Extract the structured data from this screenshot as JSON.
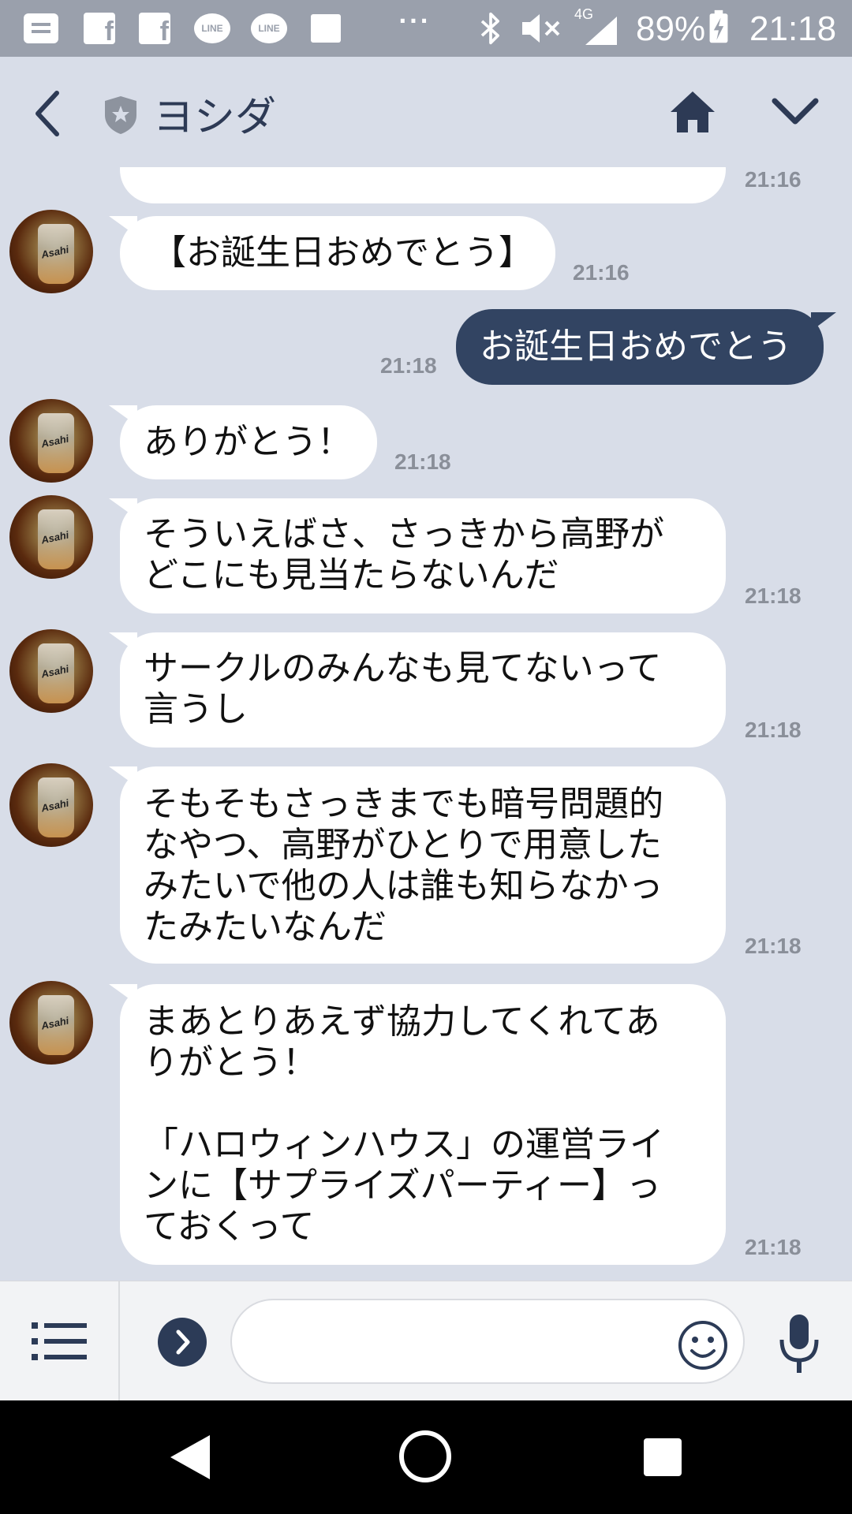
{
  "status_bar": {
    "network": "4G",
    "battery": "89%",
    "time": "21:18",
    "notification_icons": [
      "mail-icon",
      "facebook-icon",
      "facebook-icon",
      "line-icon",
      "line-icon",
      "square-icon"
    ],
    "line_icon_text": "LINE",
    "fb_letter": "f",
    "more": "···"
  },
  "header": {
    "title": "ヨシダ",
    "icons": [
      "back-icon",
      "shield-star-icon",
      "home-icon",
      "chevron-down-icon"
    ]
  },
  "messages": [
    {
      "side": "in",
      "text": "【お誕生日おめでとう】",
      "time": "21:16"
    },
    {
      "side": "out",
      "text": "お誕生日おめでとう",
      "time": "21:18"
    },
    {
      "side": "in",
      "text": "ありがとう！",
      "time": "21:18"
    },
    {
      "side": "in",
      "text": "そういえばさ、さっきから高野が\nどこにも見当たらないんだ",
      "time": "21:18"
    },
    {
      "side": "in",
      "text": "サークルのみんなも見てないって\n言うし",
      "time": "21:18"
    },
    {
      "side": "in",
      "text": "そもそもさっきまでも暗号問題的\nなやつ、高野がひとりで用意した\nみたいで他の人は誰も知らなかっ\nたみたいなんだ",
      "time": "21:18"
    },
    {
      "side": "in",
      "text": "まあとりあえず協力してくれてあ\nりがとう！\n\n「ハロウィンハウス」の運営ライ\nンに【サプライズパーティー】っ\nておくって",
      "time": "21:18"
    }
  ],
  "partial_top_time": "21:16",
  "avatar_label": "Asahi",
  "input_bar": {
    "placeholder": "",
    "icons": [
      "menu-icon",
      "expand-icon",
      "emoji-icon",
      "microphone-icon"
    ]
  },
  "nav_bar": {
    "icons": [
      "nav-back-icon",
      "nav-home-icon",
      "nav-recent-icon"
    ]
  },
  "colors": {
    "background": "#d8dde8",
    "outgoing_bubble": "#324462",
    "header_text": "#2d3a55",
    "time_text": "#8a8f99"
  }
}
